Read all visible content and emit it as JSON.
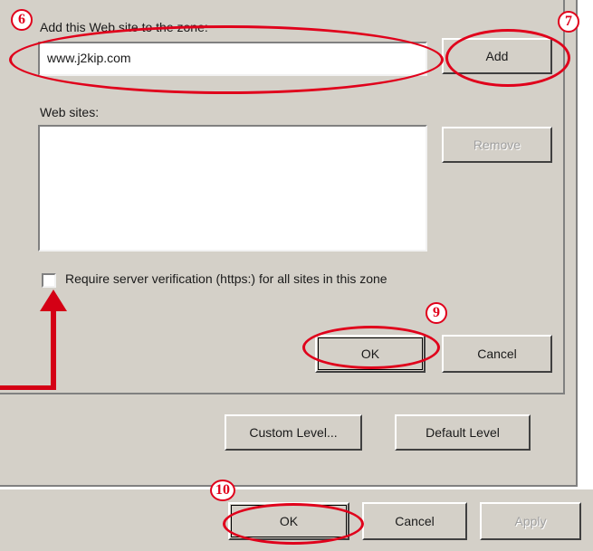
{
  "zone_dialog": {
    "add_label": "Add this Web site to the zone:",
    "add_value": "www.j2kip.com",
    "add_button": "Add",
    "websites_label": "Web sites:",
    "websites": [],
    "remove_button": "Remove",
    "require_https_label": "Require server verification (https:) for all sites in this zone",
    "require_https_checked": false,
    "ok_button": "OK",
    "cancel_button": "Cancel"
  },
  "security_tab": {
    "custom_level_button": "Custom Level...",
    "default_level_button": "Default Level"
  },
  "main_buttons": {
    "ok": "OK",
    "cancel": "Cancel",
    "apply": "Apply"
  },
  "annotations": {
    "step_6": "6",
    "step_7": "7",
    "step_9": "9",
    "step_10": "10",
    "color": "#e0001b"
  }
}
